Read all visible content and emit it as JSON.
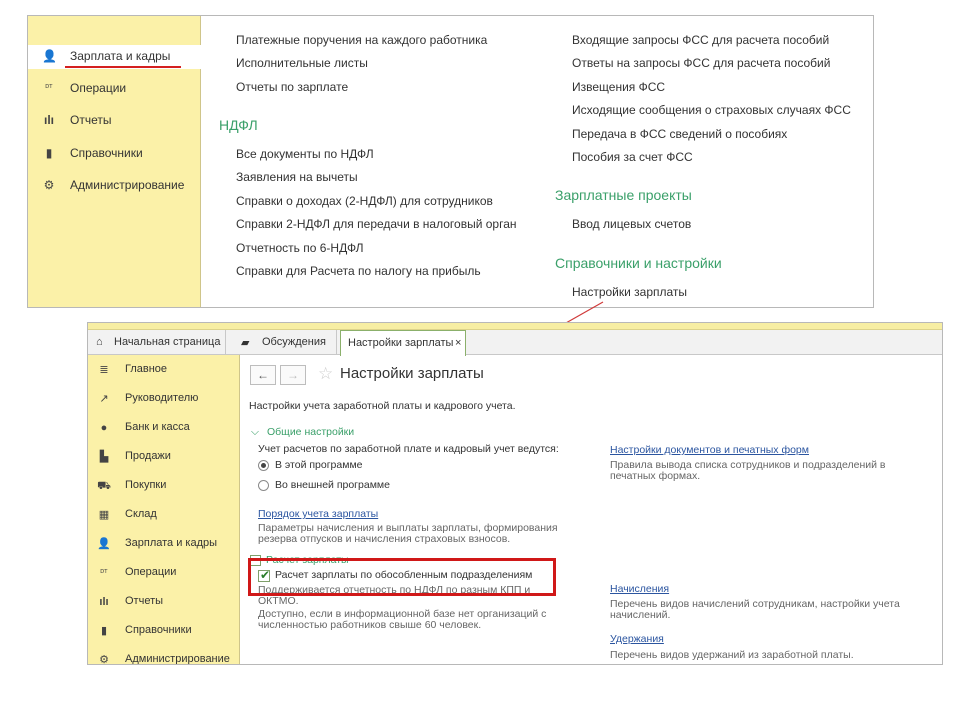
{
  "top_panel": {
    "sidebar": [
      {
        "icon": "person-icon",
        "label": "Зарплата и кадры",
        "active": true
      },
      {
        "icon": "dt-kt-icon",
        "label": "Операции"
      },
      {
        "icon": "bar-chart-icon",
        "label": "Отчеты"
      },
      {
        "icon": "book-icon",
        "label": "Справочники"
      },
      {
        "icon": "gear-icon",
        "label": "Администрирование"
      }
    ],
    "col1_links_top": [
      "Платежные поручения на каждого работника",
      "Исполнительные листы",
      "Отчеты по зарплате"
    ],
    "ndfl_heading": "НДФЛ",
    "ndfl_links": [
      "Все документы по НДФЛ",
      "Заявления на вычеты",
      "Справки о доходах (2-НДФЛ) для сотрудников",
      "Справки 2-НДФЛ для передачи в налоговый орган",
      "Отчетность по 6-НДФЛ",
      "Справки для Расчета по налогу на прибыль"
    ],
    "fss_links": [
      "Входящие запросы ФСС для расчета пособий",
      "Ответы на запросы ФСС для расчета пособий",
      "Извещения ФСС",
      "Исходящие сообщения о страховых случаях ФСС",
      "Передача в ФСС сведений о пособиях",
      "Пособия за счет ФСС"
    ],
    "salary_projects_heading": "Зарплатные проекты",
    "salary_projects_links": [
      "Ввод лицевых счетов"
    ],
    "settings_heading": "Справочники и настройки",
    "settings_links": [
      "Настройки зарплаты"
    ]
  },
  "window": {
    "tabs": [
      {
        "icon": "home-icon",
        "label": "Начальная страница"
      },
      {
        "icon": "chat-icon",
        "label": "Обсуждения"
      },
      {
        "label": "Настройки зарплаты",
        "close": "×",
        "active": true
      }
    ],
    "sidebar": [
      {
        "icon": "list-icon",
        "label": "Главное"
      },
      {
        "icon": "trend-icon",
        "label": "Руководителю"
      },
      {
        "icon": "coin-icon",
        "label": "Банк и касса"
      },
      {
        "icon": "bag-icon",
        "label": "Продажи"
      },
      {
        "icon": "cart-icon",
        "label": "Покупки"
      },
      {
        "icon": "warehouse-icon",
        "label": "Склад"
      },
      {
        "icon": "person-icon",
        "label": "Зарплата и кадры"
      },
      {
        "icon": "dt-kt-icon",
        "label": "Операции"
      },
      {
        "icon": "bar-chart-icon",
        "label": "Отчеты"
      },
      {
        "icon": "book-icon",
        "label": "Справочники"
      },
      {
        "icon": "gear-icon",
        "label": "Администрирование"
      }
    ],
    "content": {
      "back_glyph": "←",
      "forward_glyph": "→",
      "star_glyph": "☆",
      "title": "Настройки зарплаты",
      "subtitle": "Настройки учета заработной платы и кадрового учета.",
      "general_section": "Общие настройки",
      "accounting_question": "Учет расчетов по заработной плате и кадровый учет ведутся:",
      "radio_options": [
        {
          "label": "В этой программе",
          "selected": true
        },
        {
          "label": "Во внешней программе",
          "selected": false
        }
      ],
      "order_link": "Порядок учета зарплаты",
      "order_desc": "Параметры начисления и выплаты зарплаты, формирования резерва отпусков и начисления страховых взносов.",
      "payroll_section": "Расчет зарплаты",
      "checkbox_label": "Расчет зарплаты по обособленным подразделениям",
      "checkbox_checked": true,
      "check_desc_1": "Поддерживается отчетность по НДФЛ по разным КПП и ОКТМО.",
      "check_desc_2": "Доступно, если в информационной базе нет организаций с численностью работников свыше 60 человек.",
      "docs_link": "Настройки документов и печатных форм",
      "docs_desc": "Правила вывода списка сотрудников и подразделений в печатных формах.",
      "accruals_link": "Начисления",
      "accruals_desc": "Перечень видов начислений сотрудникам, настройки учета начислений.",
      "deductions_link": "Удержания",
      "deductions_desc": "Перечень видов удержаний из заработной платы."
    }
  },
  "colors": {
    "sidebar_bg": "#fbf1a8",
    "heading_green": "#3ba06a",
    "link_blue": "#2b55a0",
    "highlight_red": "#d01818"
  }
}
